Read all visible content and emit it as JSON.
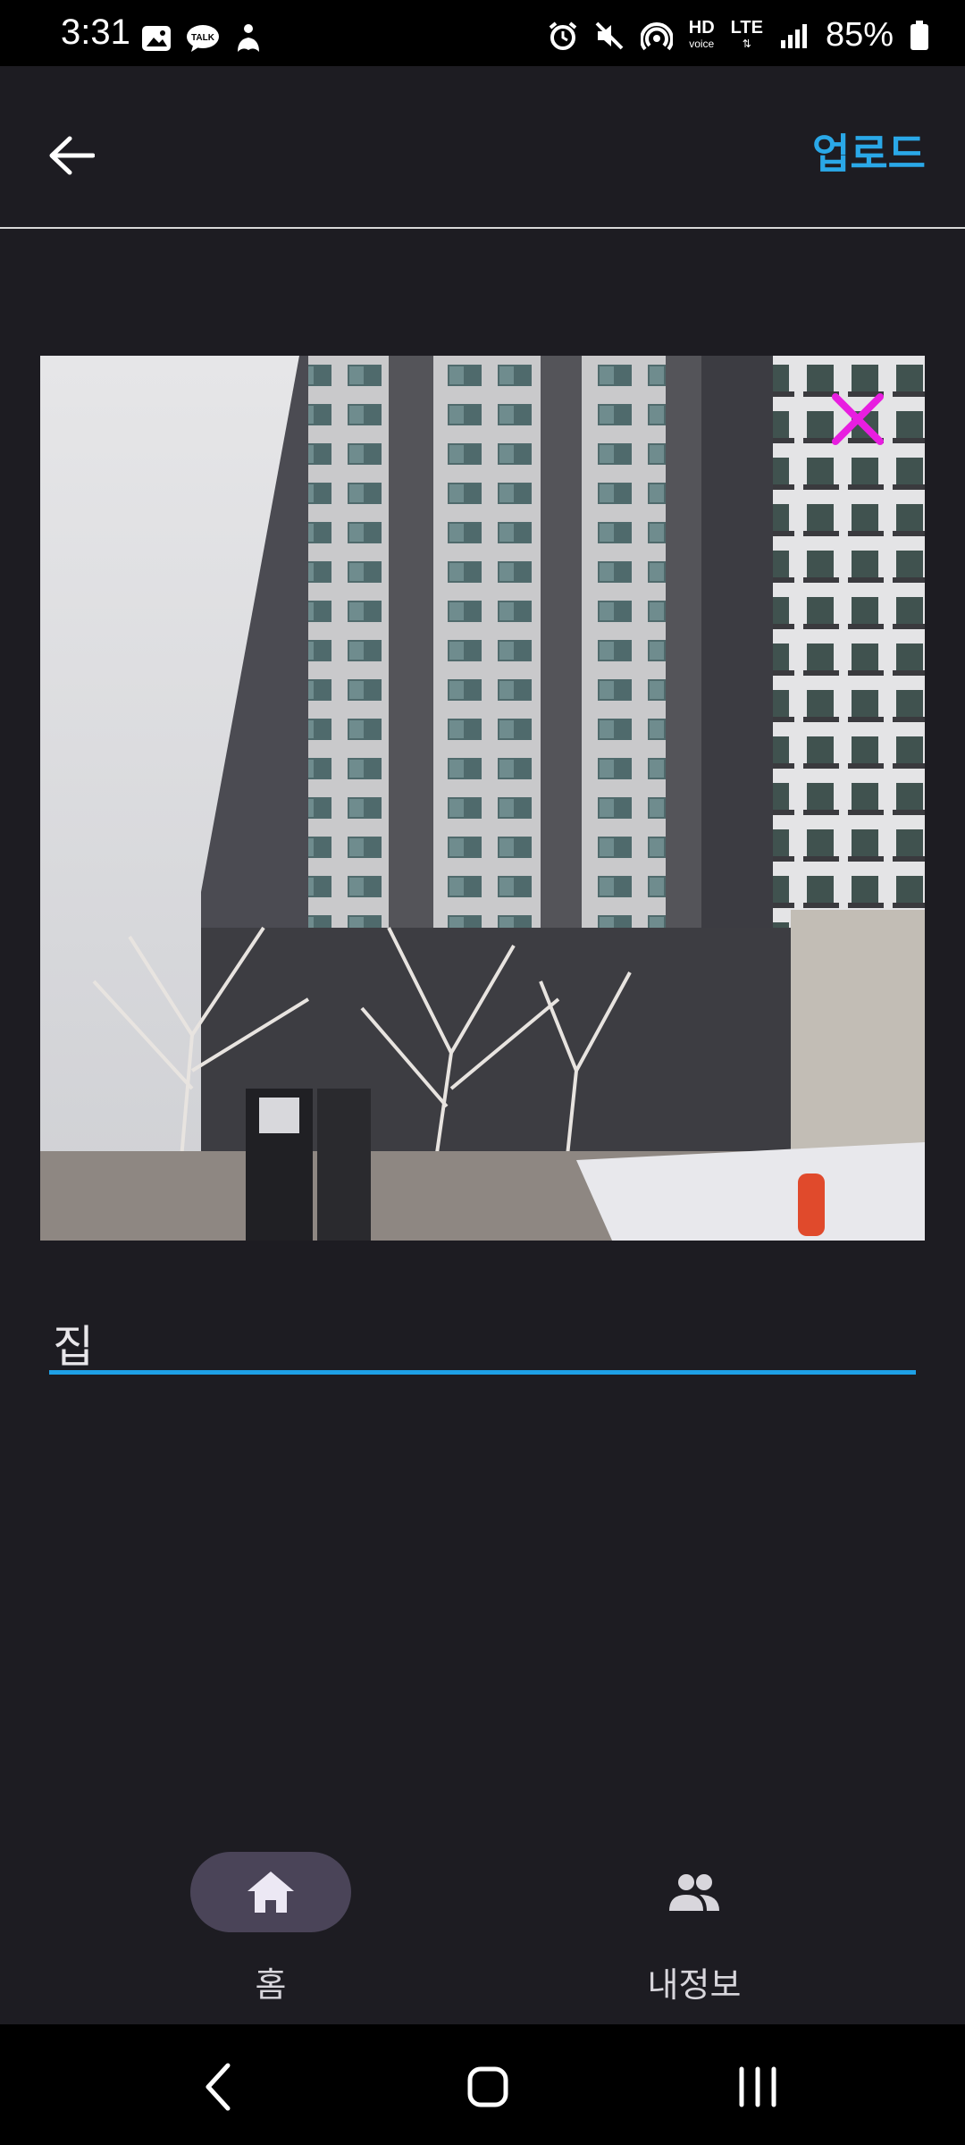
{
  "status_bar": {
    "time": "3:31",
    "network": "LTE",
    "hd_label": "HD",
    "hd_sub": "voice",
    "battery": "85%",
    "left_icons": [
      "gallery-icon",
      "kakaotalk-icon",
      "accessibility-icon"
    ],
    "right_icons": [
      "alarm-icon",
      "mute-icon",
      "hotspot-icon",
      "hd-voice-icon",
      "lte-icon",
      "signal-icon",
      "battery-icon"
    ]
  },
  "app_bar": {
    "back_icon": "arrow-left-icon",
    "upload_label": "업로드",
    "upload_color": "#2aa8e8"
  },
  "photo": {
    "remove_icon": "close-x-icon",
    "remove_color": "#e81ee0"
  },
  "caption": {
    "value": "집",
    "underline_color": "#1ea0e6"
  },
  "bottom_nav": {
    "items": [
      {
        "label": "홈",
        "icon": "home-icon",
        "selected": true
      },
      {
        "label": "내정보",
        "icon": "people-icon",
        "selected": false
      }
    ],
    "selected_pill_color": "#4a4458"
  },
  "system_nav": {
    "icons": [
      "back-chevron-icon",
      "home-square-icon",
      "recents-icon"
    ]
  }
}
